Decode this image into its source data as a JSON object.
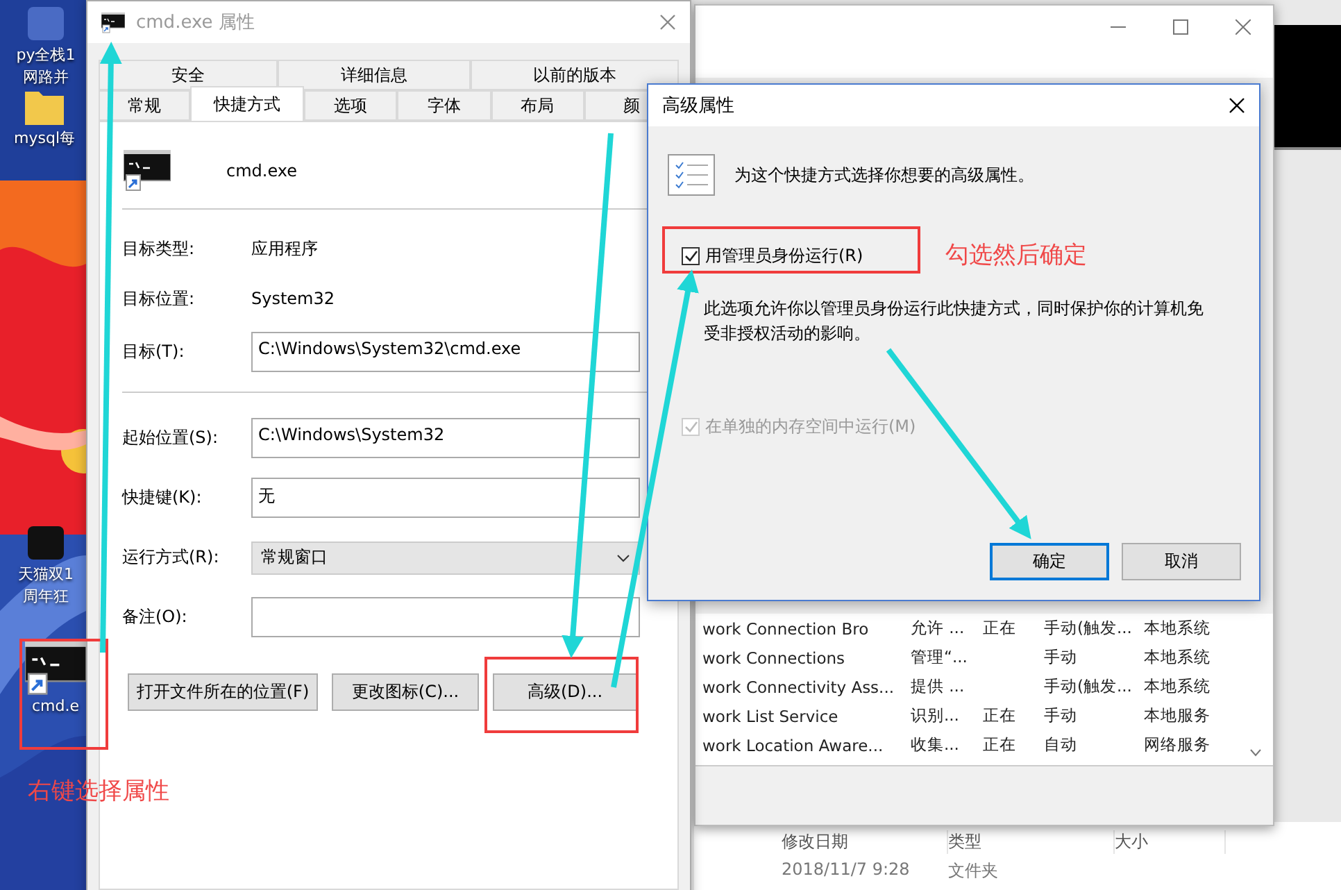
{
  "desktop_icons": [
    {
      "lines": [
        "py全栈1",
        "网路并"
      ]
    },
    {
      "lines": [
        "mysql每"
      ]
    },
    {
      "lines": [
        "天猫双1",
        "周年狂"
      ]
    },
    {
      "lines": [
        "cmd.e"
      ]
    }
  ],
  "services_window": {
    "rows": [
      {
        "name": "work Connection Bro",
        "description": "允许 ...",
        "status": "正在",
        "startup": "手动(触发...",
        "log_on_as": "本地系统"
      },
      {
        "name": "work Connections",
        "description": "管理“...",
        "startup": "手动",
        "log_on_as": "本地系统"
      },
      {
        "name": "work Connectivity Ass...",
        "description": "提供 ...",
        "startup": "手动(触发...",
        "log_on_as": "本地系统"
      },
      {
        "name": "work List Service",
        "description": "识别...",
        "status": "正在",
        "startup": "手动",
        "log_on_as": "本地服务"
      },
      {
        "name": "work Location Aware...",
        "description": "收集...",
        "status": "正在",
        "startup": "自动",
        "log_on_as": "网络服务"
      }
    ]
  },
  "file_list": {
    "columns": [
      "修改日期",
      "类型",
      "大小"
    ],
    "rows": [
      {
        "date": "2018/11/7 9:28",
        "type": "文件夹"
      }
    ]
  },
  "properties_dialog": {
    "title": "cmd.exe 属性",
    "tab_rows": [
      [
        {
          "label": "安全",
          "selected": false
        },
        {
          "label": "详细信息",
          "selected": false
        },
        {
          "label": "以前的版本",
          "selected": false
        }
      ],
      [
        {
          "label": "常规",
          "selected": false
        },
        {
          "label": "快捷方式",
          "selected": true
        },
        {
          "label": "选项",
          "selected": false
        },
        {
          "label": "字体",
          "selected": false
        },
        {
          "label": "布局",
          "selected": false
        },
        {
          "label": "颜",
          "selected": false
        }
      ]
    ],
    "shortcut_name": "cmd.exe",
    "target_rows": [
      {
        "kind": "info",
        "label": "目标类型:",
        "value": "应用程序"
      },
      {
        "kind": "info",
        "label": "目标位置:",
        "value": "System32"
      },
      {
        "kind": "field",
        "label": "目标(T):",
        "value": "C:\\Windows\\System32\\cmd.exe"
      }
    ],
    "start_rows": [
      {
        "kind": "field",
        "label": "起始位置(S):",
        "value": "C:\\Windows\\System32"
      },
      {
        "kind": "field",
        "label": "快捷键(K):",
        "value": "无"
      },
      {
        "kind": "select",
        "label": "运行方式(R):",
        "value": "常规窗口"
      },
      {
        "kind": "field",
        "label": "备注(O):"
      }
    ],
    "buttons": [
      "打开文件所在的位置(F)",
      "更改图标(C)...",
      "高级(D)..."
    ]
  },
  "advanced_dialog": {
    "title": "高级属性",
    "intro": "为这个快捷方式选择你想要的高级属性。",
    "options": [
      {
        "label": "用管理员身份运行(R)",
        "checked": true,
        "disabled": false,
        "note": "此选项允许你以管理员身份运行此快捷方式，同时保护你的计算机免受非授权活动的影响。"
      },
      {
        "label": "在单独的内存空间中运行(M)",
        "checked": true,
        "disabled": true
      }
    ],
    "buttons": [
      {
        "label": "确定",
        "default": true
      },
      {
        "label": "取消",
        "default": false
      }
    ]
  },
  "annotations": [
    "右键选择属性",
    "勾选然后确定"
  ]
}
